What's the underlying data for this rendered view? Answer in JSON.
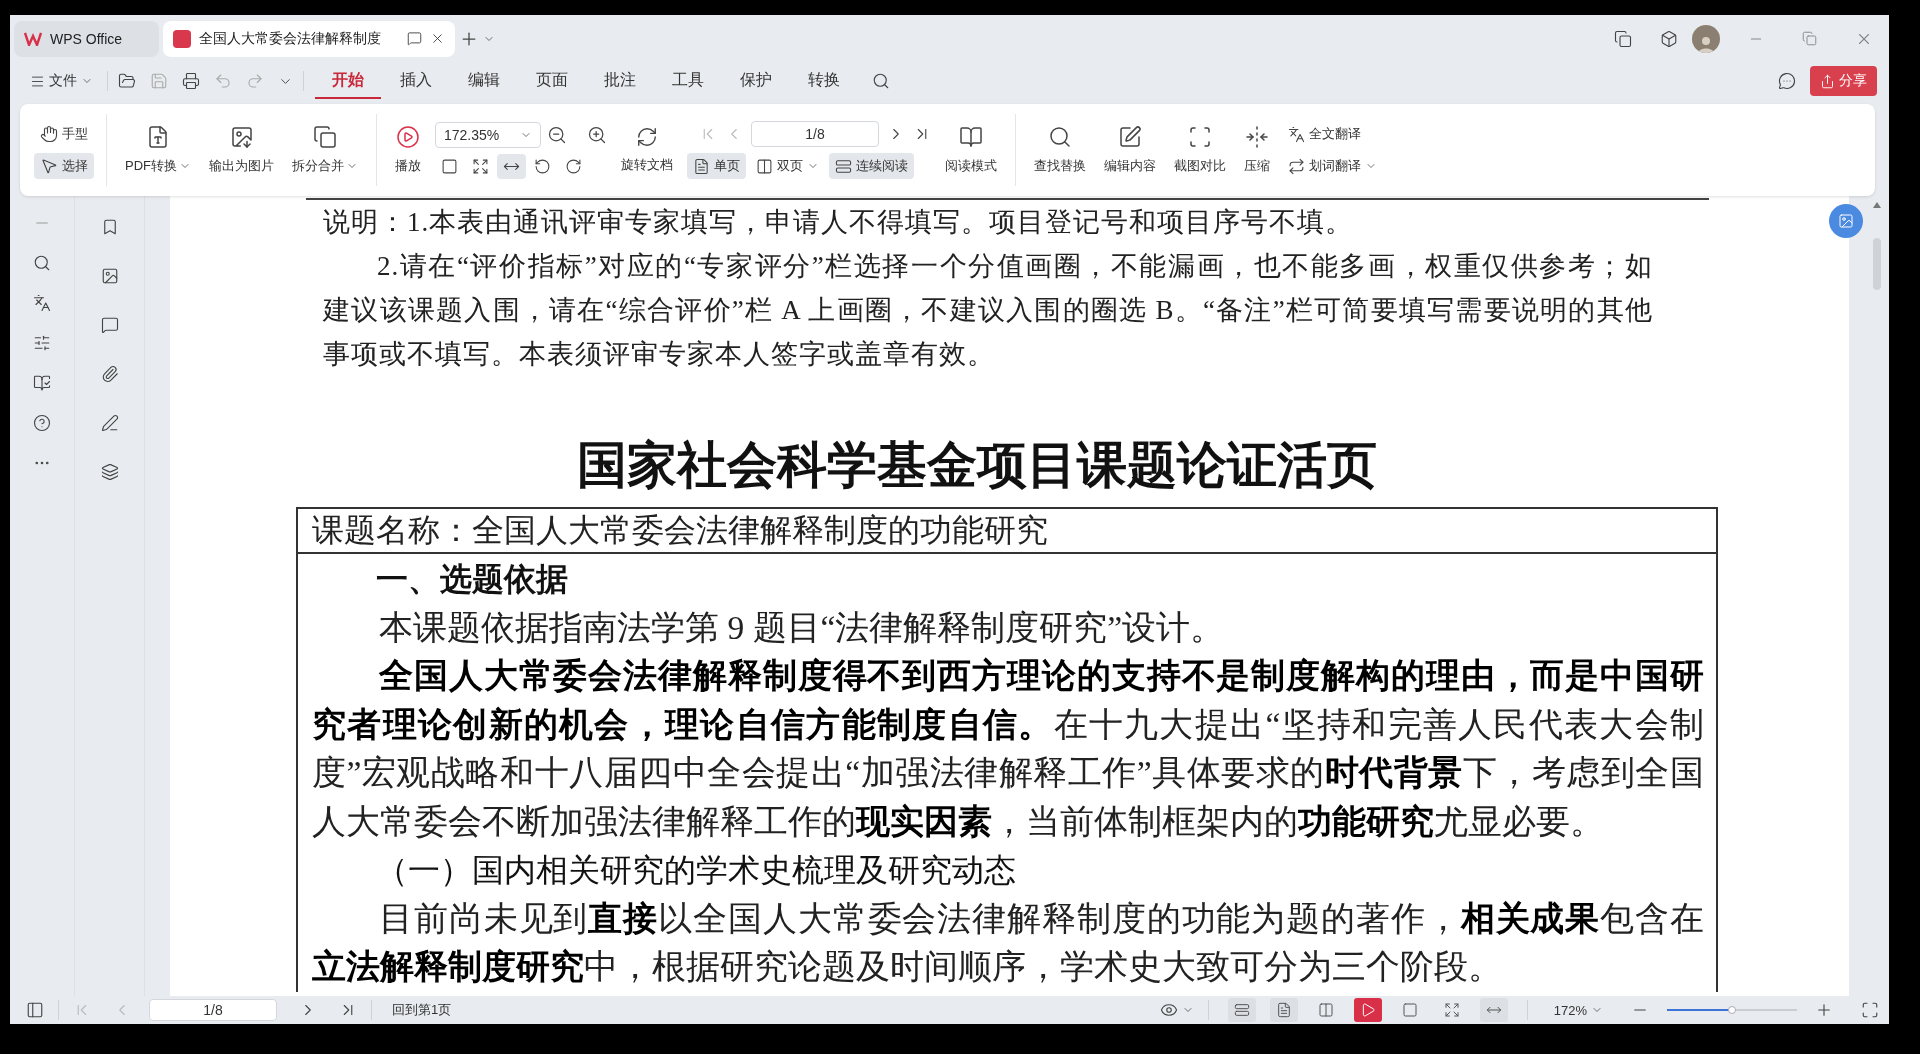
{
  "tabs": [
    {
      "kind": "home",
      "label": "WPS Office",
      "selected": false
    },
    {
      "kind": "document",
      "label": "全国人大常委会法律解释制度",
      "selected": true
    }
  ],
  "menu": {
    "file": "文件",
    "ribbon_tabs": [
      {
        "label": "开始",
        "selected": true
      },
      {
        "label": "插入",
        "selected": false
      },
      {
        "label": "编辑",
        "selected": false
      },
      {
        "label": "页面",
        "selected": false
      },
      {
        "label": "批注",
        "selected": false
      },
      {
        "label": "工具",
        "selected": false
      },
      {
        "label": "保护",
        "selected": false
      },
      {
        "label": "转换",
        "selected": false
      }
    ],
    "share": "分享"
  },
  "toolbar": {
    "pointer_tools": [
      {
        "kind": "hand",
        "label": "手型",
        "selected": false
      },
      {
        "kind": "select",
        "label": "选择",
        "selected": true
      }
    ],
    "convert_tools": [
      {
        "kind": "pdf",
        "label": "PDF转换",
        "dropdown": true
      },
      {
        "kind": "image",
        "label": "输出为图片",
        "dropdown": false
      },
      {
        "kind": "split",
        "label": "拆分合并",
        "dropdown": true
      }
    ],
    "play": {
      "label": "播放"
    },
    "zoom": {
      "value": "172.35%"
    },
    "fit_tools": [
      {
        "kind": "actual",
        "selected": false
      },
      {
        "kind": "fit-page",
        "selected": false
      },
      {
        "kind": "fit-width",
        "selected": true
      },
      {
        "kind": "rotate-left",
        "selected": false
      },
      {
        "kind": "rotate-right",
        "selected": false
      }
    ],
    "rotate": {
      "label": "旋转文档"
    },
    "page": {
      "value": "1/8"
    },
    "view_modes": [
      {
        "kind": "single",
        "label": "单页",
        "selected": true,
        "dropdown": false
      },
      {
        "kind": "double",
        "label": "双页",
        "selected": false,
        "dropdown": true
      },
      {
        "kind": "continuous",
        "label": "连续阅读",
        "selected": true,
        "dropdown": false
      }
    ],
    "read_mode": {
      "label": "阅读模式"
    },
    "edit_tools": [
      {
        "kind": "find",
        "label": "查找替换"
      },
      {
        "kind": "edit",
        "label": "编辑内容"
      },
      {
        "kind": "compare",
        "label": "截图对比"
      },
      {
        "kind": "compress",
        "label": "压缩"
      }
    ],
    "translate": [
      {
        "kind": "full",
        "label": "全文翻译",
        "dropdown": false
      },
      {
        "kind": "word",
        "label": "划词翻译",
        "dropdown": true
      }
    ]
  },
  "document": {
    "notes": [
      {
        "kind": "first",
        "text": "说明：1.本表由通讯评审专家填写，申请人不得填写。项目登记号和项目序号不填。"
      },
      {
        "kind": "indented",
        "text": "2.请在“评价指标”对应的“专家评分”栏选择一个分值画圈，不能漏画，也不能多画，权重仅供参考；如建议该课题入围，请在“综合评价”栏 A 上画圈，不建议入围的圈选 B。“备注”栏可简要填写需要说明的其他事项或不填写。本表须评审专家本人签字或盖章有效。"
      }
    ],
    "title": "国家社会科学基金项目课题论证活页",
    "table": {
      "topic": "课题名称：全国人大常委会法律解释制度的功能研究",
      "blocks": [
        {
          "kind": "heading",
          "text": "一、选题依据"
        },
        {
          "kind": "paragraph",
          "text": "本课题依据指南法学第 9 题目“法律解释制度研究”设计。"
        },
        {
          "kind": "paragraph",
          "text": "**全国人大常委会法律解释制度得不到西方理论的支持不是制度解构的理由，而是中国研究者理论创新的机会，理论自信方能制度自信。**在十九大提出“坚持和完善人民代表大会制度”宏观战略和十八届四中全会提出“加强法律解释工作”具体要求的**时代背景**下，考虑到全国人大常委会不断加强法律解释工作的**现实因素**，当前体制框架内的**功能研究**尤显必要。"
        },
        {
          "kind": "subheading",
          "text": "（一）国内相关研究的学术史梳理及研究动态"
        },
        {
          "kind": "paragraph",
          "text": "目前尚未见到**直接**以全国人大常委会法律解释制度的功能为题的著作，**相关成果**包含在**立法解释制度研究**中，根据研究论题及时间顺序，学术史大致可分为三个阶段。"
        }
      ]
    }
  },
  "status_bar": {
    "page": "1/8",
    "back_link": "回到第1页",
    "view_buttons": [
      {
        "kind": "continuous",
        "selected": true
      },
      {
        "kind": "single",
        "selected": true
      },
      {
        "kind": "double",
        "selected": false
      },
      {
        "kind": "play",
        "selected": true
      },
      {
        "kind": "actual",
        "selected": false
      },
      {
        "kind": "fit-page",
        "selected": false
      },
      {
        "kind": "fit-width",
        "selected": true
      }
    ],
    "zoom": "172%",
    "zoom_slider": {
      "level": 0.5
    }
  }
}
